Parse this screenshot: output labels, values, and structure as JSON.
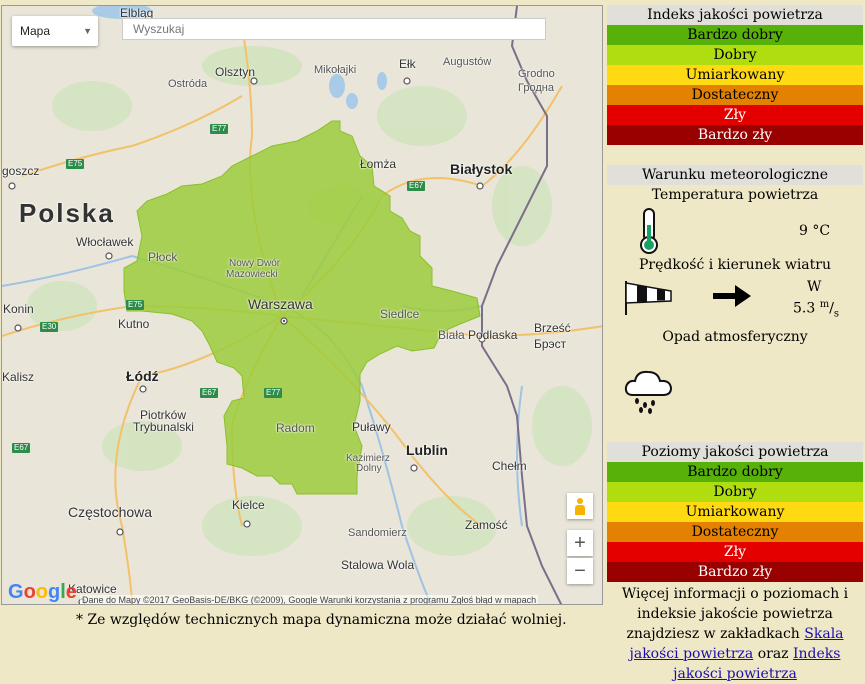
{
  "map": {
    "type_label": "Mapa",
    "search_placeholder": "Wyszukaj",
    "highlight_color": "#9ccc3c",
    "cities": {
      "elblag": "Elbląg",
      "olsztyn": "Olsztyn",
      "mikolajki": "Mikołajki",
      "elk": "Ełk",
      "augustow": "Augustów",
      "grodno": "Grodno",
      "grodno_cyr": "Гродна",
      "ostroda": "Ostróda",
      "goszcz": "goszcz",
      "lomza": "Łomża",
      "bialystok": "Białystok",
      "polska": "Polska",
      "wloclawek": "Włocławek",
      "plock": "Płock",
      "nowy_dwor": "Nowy Dwór",
      "nowy_dwor2": "Mazowiecki",
      "warszawa": "Warszawa",
      "siedlce": "Siedlce",
      "biala": "Biała",
      "podlaska": "Podlaska",
      "brzesc": "Brześć",
      "brest_cyr": "Брэст",
      "konin": "Konin",
      "kutno": "Kutno",
      "kalisz": "Kalisz",
      "lodz": "Łódź",
      "piotrkow": "Piotrków",
      "trybunalski": "Trybunalski",
      "radom": "Radom",
      "pulawy": "Puławy",
      "lublin": "Lublin",
      "kazimierz": "Kazimierz",
      "dolny": "Dolny",
      "chelm": "Chełm",
      "kielce": "Kielce",
      "czestochowa": "Częstochowa",
      "sandomierz": "Sandomierz",
      "zamosc": "Zamość",
      "stalowa_wola": "Stalowa Wola",
      "katowice": "Katowice"
    },
    "roads": {
      "e77a": "E77",
      "e75a": "E75",
      "e67a": "E67",
      "e75b": "E75",
      "e30": "E30",
      "e67b": "E67",
      "e77b": "E77",
      "e67c": "E67"
    },
    "zoom_in": "+",
    "zoom_out": "−",
    "google_logo": "Google",
    "attribution": "Dane do Mapy ©2017 GeoBasis-DE/BKG (©2009), Google     Warunki korzystania z programu     Zgłoś błąd w mapach"
  },
  "footnote": "* Ze względów technicznych mapa dynamiczna może działać wolniej.",
  "index_panel": {
    "title": "Indeks jakości powietrza",
    "levels": [
      {
        "label": "Bardzo dobry",
        "color": "#57b108",
        "text_color": "#000"
      },
      {
        "label": "Dobry",
        "color": "#b0dd10",
        "text_color": "#000"
      },
      {
        "label": "Umiarkowany",
        "color": "#ffd911",
        "text_color": "#000"
      },
      {
        "label": "Dostateczny",
        "color": "#e58100",
        "text_color": "#000"
      },
      {
        "label": "Zły",
        "color": "#e50000",
        "text_color": "#fff"
      },
      {
        "label": "Bardzo zły",
        "color": "#990000",
        "text_color": "#fff"
      }
    ]
  },
  "meteo": {
    "title": "Warunku meteorologiczne",
    "temp_label": "Temperatura powietrza",
    "temp_value": "9",
    "temp_unit": "°C",
    "wind_label": "Prędkość i kierunek wiatru",
    "wind_dir": "W",
    "wind_speed": "5.3",
    "wind_unit_top": "m",
    "wind_unit_bottom": "s",
    "precip_label": "Opad atmosferyczny",
    "icons": [
      "thermometer-icon",
      "windsock-icon",
      "arrow-right-icon",
      "rain-cloud-icon"
    ]
  },
  "levels_panel": {
    "title": "Poziomy jakości powietrza",
    "levels": [
      {
        "label": "Bardzo dobry",
        "color": "#57b108",
        "text_color": "#000"
      },
      {
        "label": "Dobry",
        "color": "#b0dd10",
        "text_color": "#000"
      },
      {
        "label": "Umiarkowany",
        "color": "#ffd911",
        "text_color": "#000"
      },
      {
        "label": "Dostateczny",
        "color": "#e58100",
        "text_color": "#000"
      },
      {
        "label": "Zły",
        "color": "#e50000",
        "text_color": "#fff"
      },
      {
        "label": "Bardzo zły",
        "color": "#990000",
        "text_color": "#fff"
      }
    ]
  },
  "info": {
    "text1": "Więcej informacji o poziomach i indeksie jakoście powietrza znajdziesz w zakładkach",
    "link1": "Skala jakości powietrza",
    "text2": "oraz",
    "link2": "Indeks jakości powietrza"
  }
}
